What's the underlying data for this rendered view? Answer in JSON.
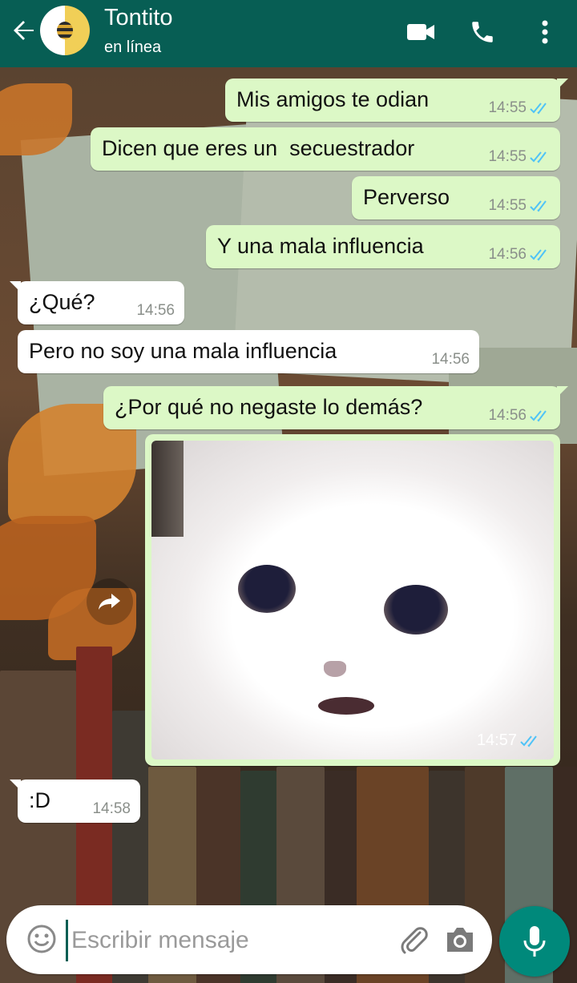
{
  "header": {
    "contact_name": "Tontito",
    "status": "en línea",
    "icons": [
      "back-arrow-icon",
      "video-call-icon",
      "phone-icon",
      "more-vertical-icon"
    ],
    "color": "#075e54"
  },
  "messages": [
    {
      "direction": "out",
      "text": "Mis amigos te odian",
      "time": "14:55",
      "read": true
    },
    {
      "direction": "out",
      "text": "Dicen que eres un  secuestrador",
      "time": "14:55",
      "read": true
    },
    {
      "direction": "out",
      "text": "Perverso",
      "time": "14:55",
      "read": true
    },
    {
      "direction": "out",
      "text": "Y una mala influencia",
      "time": "14:56",
      "read": true
    },
    {
      "direction": "in",
      "text": "¿Qué?",
      "time": "14:56"
    },
    {
      "direction": "in",
      "text": "Pero no soy una mala influencia",
      "time": "14:56"
    },
    {
      "direction": "out",
      "text": "¿Por qué no negaste lo demás?",
      "time": "14:56",
      "read": true
    },
    {
      "direction": "out",
      "type": "image",
      "image": "crying white cat",
      "time": "14:57",
      "read": true
    },
    {
      "direction": "in",
      "text": ":D",
      "time": "14:58"
    }
  ],
  "composer": {
    "placeholder": "Escribir mensaje",
    "icons": [
      "emoji-icon",
      "attach-icon",
      "camera-icon",
      "mic-icon"
    ]
  },
  "colors": {
    "outgoing_bubble": "#dcf8c6",
    "incoming_bubble": "#ffffff",
    "read_ticks": "#4fc3f7",
    "mic_button": "#00897b"
  }
}
